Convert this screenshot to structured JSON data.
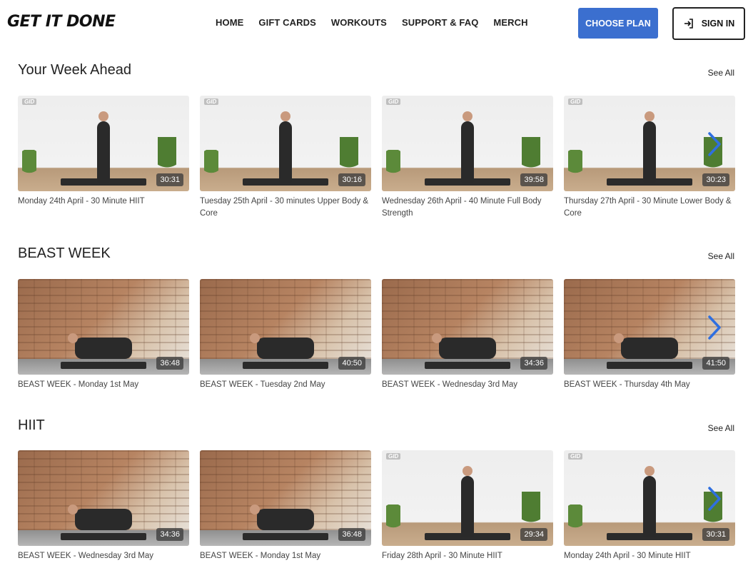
{
  "header": {
    "logo": "GET IT DONE",
    "nav": [
      "HOME",
      "GIFT CARDS",
      "WORKOUTS",
      "SUPPORT & FAQ",
      "MERCH"
    ],
    "choose_plan": "CHOOSE PLAN",
    "sign_in": "SIGN IN"
  },
  "sections": [
    {
      "title": "Your Week Ahead",
      "see_all": "See All",
      "cards": [
        {
          "duration": "30:31",
          "caption": "Monday 24th April - 30 Minute HIIT"
        },
        {
          "duration": "30:16",
          "caption": "Tuesday 25th April - 30 minutes Upper Body & Core"
        },
        {
          "duration": "39:58",
          "caption": "Wednesday 26th April - 40 Minute Full Body Strength"
        },
        {
          "duration": "30:23",
          "caption": "Thursday 27th April - 30 Minute Lower Body & Core"
        }
      ]
    },
    {
      "title": "BEAST WEEK",
      "see_all": "See All",
      "cards": [
        {
          "duration": "36:48",
          "caption": "BEAST WEEK - Monday 1st May"
        },
        {
          "duration": "40:50",
          "caption": "BEAST WEEK - Tuesday 2nd May"
        },
        {
          "duration": "34:36",
          "caption": "BEAST WEEK - Wednesday 3rd May"
        },
        {
          "duration": "41:50",
          "caption": "BEAST WEEK - Thursday 4th May"
        }
      ]
    },
    {
      "title": "HIIT",
      "see_all": "See All",
      "cards": [
        {
          "duration": "34:36",
          "caption": "BEAST WEEK - Wednesday 3rd May"
        },
        {
          "duration": "36:48",
          "caption": "BEAST WEEK - Monday 1st May"
        },
        {
          "duration": "29:34",
          "caption": "Friday 28th April - 30 Minute HIIT"
        },
        {
          "duration": "30:31",
          "caption": "Monday 24th April - 30 Minute HIIT"
        }
      ]
    }
  ],
  "thumb_badge": "GID",
  "colors": {
    "accent": "#3b6fcf",
    "arrow": "#2f6fe0"
  }
}
